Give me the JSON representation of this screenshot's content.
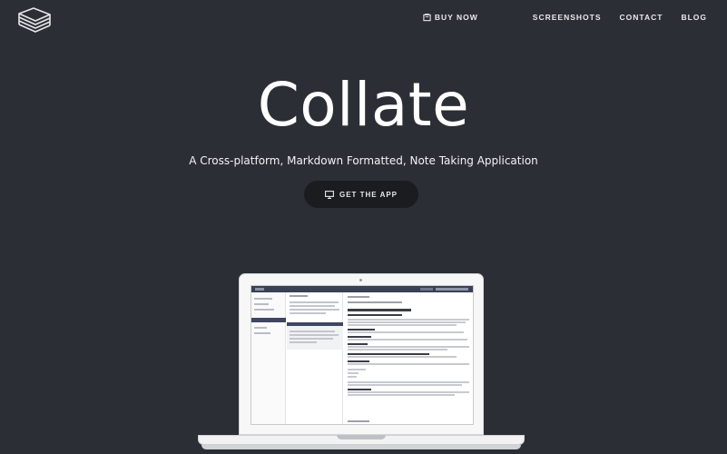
{
  "header": {
    "logo_icon": "stacked-papers-icon",
    "nav": {
      "buy_icon": "cart-icon",
      "buy_label": "BUY NOW",
      "screenshots_label": "SCREENSHOTS",
      "contact_label": "CONTACT",
      "blog_label": "BLOG"
    }
  },
  "hero": {
    "title": "Collate",
    "subtitle": "A Cross-platform, Markdown Formatted, Note Taking Application",
    "cta_icon": "monitor-icon",
    "cta_label": "GET THE APP"
  },
  "preview": {
    "device_icon": "laptop-icon"
  },
  "colors": {
    "background": "#2b2e35",
    "button": "#1a1c20",
    "text": "#ffffff",
    "app_accent": "#3f4660"
  }
}
